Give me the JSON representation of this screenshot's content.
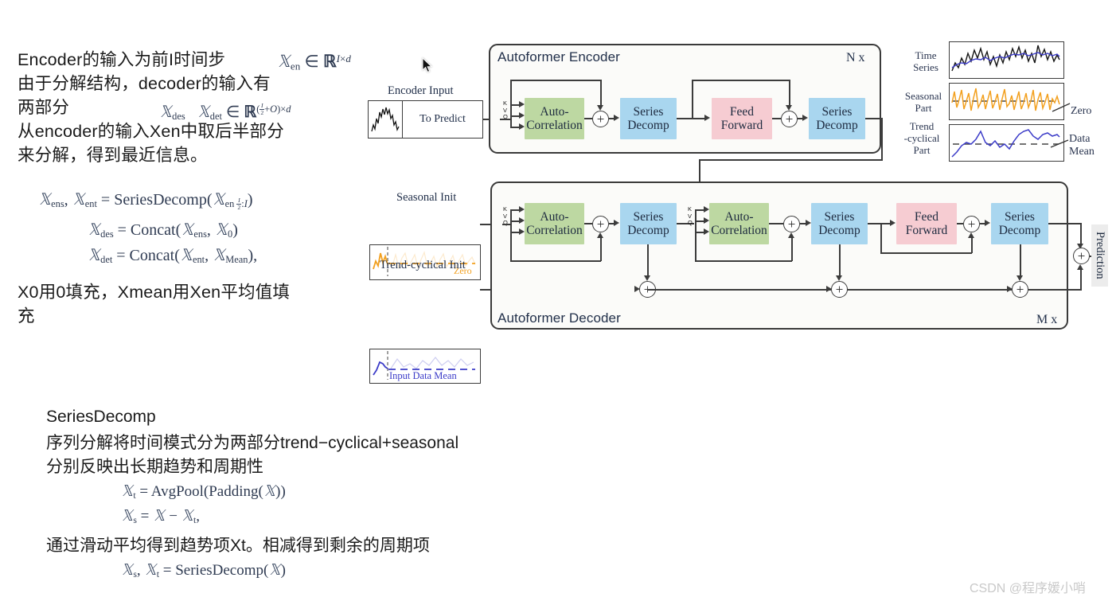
{
  "notes_top": {
    "lines": [
      "Encoder的输入为前I时间步",
      "由于分解结构，decoder的输入有",
      "两部分",
      "从encoder的输入Xen中取后半部分",
      "来分解，得到最近信息。"
    ],
    "formula_inline_1": "Xen ∈ ℝ^(I×d)",
    "formula_inline_2": "Xdes  Xdet ∈ ℝ^((I/2+O)×d)",
    "equations": [
      "Xens, Xent = SeriesDecomp(Xen I/2:I)",
      "Xdes = Concat(Xens, X0)",
      "Xdet = Concat(Xent, XMean),"
    ],
    "closing_lines": [
      "X0用0填充，Xmean用Xen平均值填",
      "充"
    ]
  },
  "notes_bottom": {
    "heading": "SeriesDecomp",
    "lines": [
      "序列分解将时间模式分为两部分trend−cyclical+seasonal",
      "分别反映出长期趋势和周期性"
    ],
    "equations_1": [
      "Xt = AvgPool(Padding(X))",
      "Xs = X − Xt,"
    ],
    "line_mid": "通过滑动平均得到趋势项Xt。相减得到剩余的周期项",
    "equations_2": [
      "Xs, Xt = SeriesDecomp(X)"
    ]
  },
  "diagram": {
    "encoder": {
      "title": "Autoformer Encoder",
      "repeat": "N x",
      "input_caption": "Encoder Input",
      "input_label": "To Predict",
      "blocks": [
        {
          "label_top": "Auto-",
          "label_bottom": "Correlation",
          "color": "green"
        },
        {
          "label_top": "Series",
          "label_bottom": "Decomp",
          "color": "blue"
        },
        {
          "label_top": "Feed",
          "label_bottom": "Forward",
          "color": "pink"
        },
        {
          "label_top": "Series",
          "label_bottom": "Decomp",
          "color": "blue"
        }
      ],
      "kvq": [
        "K",
        "V",
        "Q"
      ]
    },
    "decoder": {
      "title": "Autoformer Decoder",
      "repeat": "M x",
      "seasonal_caption": "Seasonal Init",
      "seasonal_inner_label": "Zero",
      "trend_caption": "Trend-cyclical Init",
      "trend_inner_label": "Input Data Mean",
      "blocks": [
        {
          "label_top": "Auto-",
          "label_bottom": "Correlation",
          "color": "green"
        },
        {
          "label_top": "Series",
          "label_bottom": "Decomp",
          "color": "blue"
        },
        {
          "label_top": "Auto-",
          "label_bottom": "Correlation",
          "color": "green"
        },
        {
          "label_top": "Series",
          "label_bottom": "Decomp",
          "color": "blue"
        },
        {
          "label_top": "Feed",
          "label_bottom": "Forward",
          "color": "pink"
        },
        {
          "label_top": "Series",
          "label_bottom": "Decomp",
          "color": "blue"
        }
      ],
      "kvq": [
        "K",
        "V",
        "Q"
      ],
      "output_label": "Prediction"
    },
    "legend": {
      "rows": [
        {
          "label_line1": "Time",
          "label_line2": "Series",
          "side": ""
        },
        {
          "label_line1": "Seasonal",
          "label_line2": "Part",
          "side": "Zero"
        },
        {
          "label_line1": "Trend",
          "label_line2": "-cyclical",
          "label_line3": "Part",
          "side_line1": "Data",
          "side_line2": "Mean"
        }
      ]
    },
    "plus_symbol": "+"
  },
  "colors": {
    "green": "#bdd8a2",
    "blue": "#a9d6ef",
    "pink": "#f6ccd2",
    "wire": "#3c3c3c",
    "panel_border": "#3a3a3a",
    "orange": "#f0a020",
    "purple": "#4b4bc8",
    "math_text": "#2f3b52"
  },
  "watermark": {
    "text": "CSDN @程序媛小哨"
  }
}
